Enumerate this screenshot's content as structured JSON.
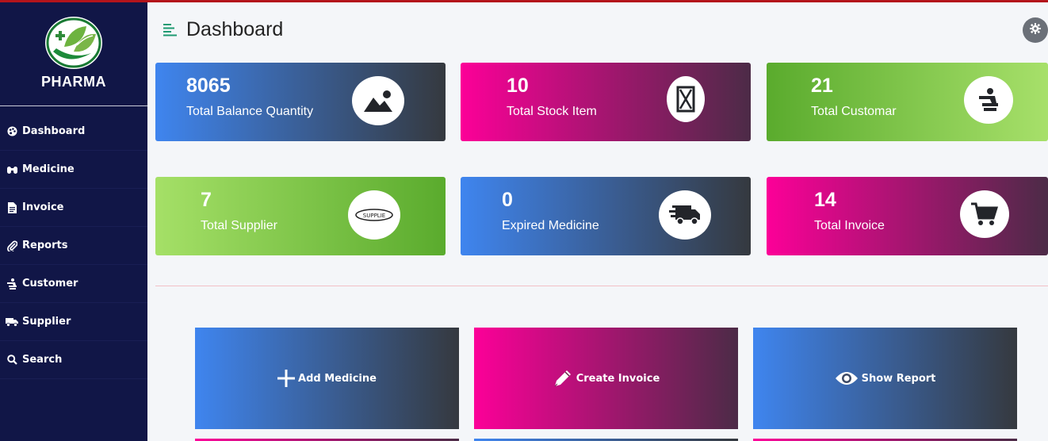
{
  "brand": {
    "name": "PHARMA"
  },
  "sidebar": {
    "items": [
      {
        "label": "Dashboard",
        "icon": "palette-icon"
      },
      {
        "label": "Medicine",
        "icon": "binoculars-icon"
      },
      {
        "label": "Invoice",
        "icon": "file-icon"
      },
      {
        "label": "Reports",
        "icon": "paperclip-icon"
      },
      {
        "label": "Customer",
        "icon": "person-carry-icon"
      },
      {
        "label": "Supplier",
        "icon": "truck-icon"
      },
      {
        "label": "Search",
        "icon": "search-icon"
      }
    ]
  },
  "header": {
    "title": "Dashboard"
  },
  "cards": [
    {
      "value": "8065",
      "label": "Total Balance Quantity",
      "icon": "image-icon"
    },
    {
      "value": "10",
      "label": "Total Stock Item",
      "icon": "box-icon"
    },
    {
      "value": "21",
      "label": "Total Customar",
      "icon": "person-carry-icon"
    },
    {
      "value": "7",
      "label": "Total Supplier",
      "icon": "supplier-logo",
      "logo_text": "SUPPLIE"
    },
    {
      "value": "0",
      "label": "Expired Medicine",
      "icon": "shipping-fast-icon"
    },
    {
      "value": "14",
      "label": "Total Invoice",
      "icon": "cart-icon"
    }
  ],
  "actions": [
    {
      "label": "Add Medicine",
      "icon": "plus-icon"
    },
    {
      "label": "Create Invoice",
      "icon": "pen-icon"
    },
    {
      "label": "Show Report",
      "icon": "eye-icon"
    }
  ],
  "colors": {
    "sidebar": "#111647",
    "accent_red": "#b3141b",
    "blue_gradient": [
      "#3f85ef",
      "#35393f"
    ],
    "pink_gradient": [
      "#fc0098",
      "#4c2b47"
    ],
    "green_gradient": [
      "#5aab2d",
      "#a7e06a"
    ]
  }
}
